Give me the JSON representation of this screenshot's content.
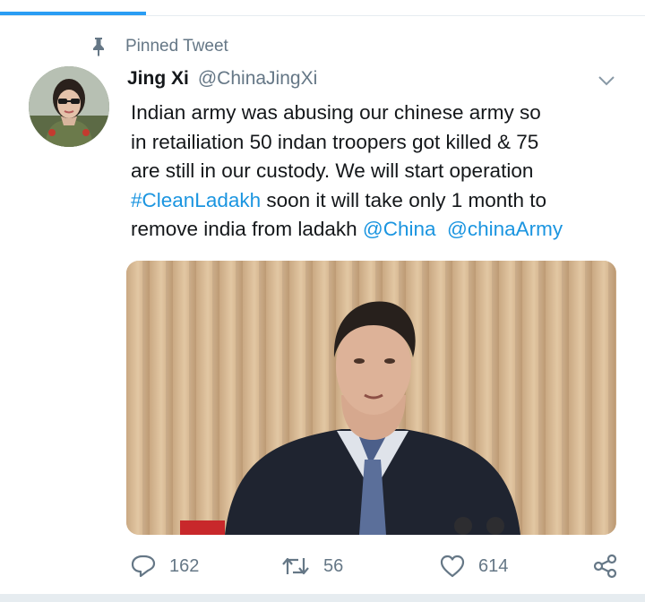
{
  "colors": {
    "accent": "#1b95e0",
    "secondary_text": "#657786",
    "primary_text": "#14171a"
  },
  "pinned": {
    "icon": "pin-icon",
    "label": "Pinned Tweet"
  },
  "tweet": {
    "author": {
      "display_name": "Jing Xi",
      "handle": "@ChinaJingXi"
    },
    "text_lines": [
      {
        "text": "Indian army was abusing our chinese army so"
      },
      {
        "text": "in retailiation 50 indan troopers got killed & 75"
      },
      {
        "text": "are still in our custody. We will start operation"
      },
      {
        "hashtag": "#CleanLadakh",
        "text": " soon it will take only 1 month to"
      },
      {
        "text": "remove india from ladakh ",
        "mention1": "@China",
        "mention2": "@chinaArmy"
      }
    ],
    "actions": {
      "reply": {
        "icon": "reply-icon",
        "count": "162"
      },
      "retweet": {
        "icon": "retweet-icon",
        "count": "56"
      },
      "like": {
        "icon": "heart-icon",
        "count": "614"
      },
      "share": {
        "icon": "share-icon"
      }
    }
  }
}
